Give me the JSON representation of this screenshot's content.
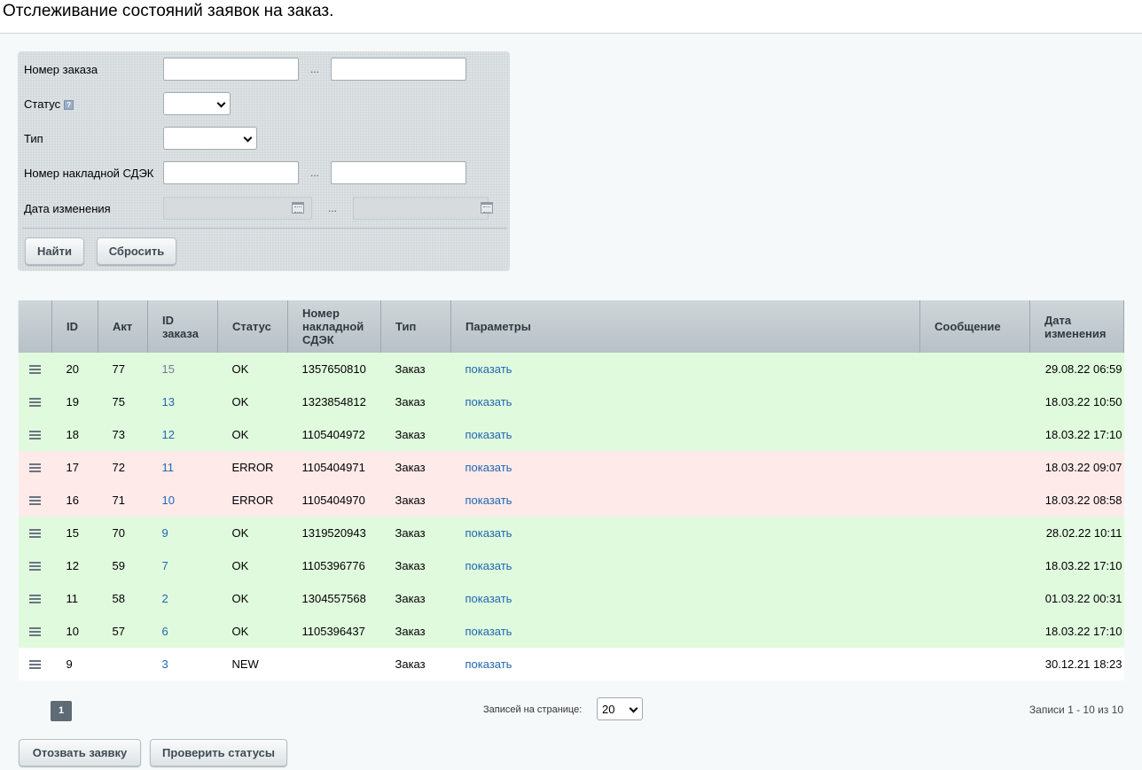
{
  "page": {
    "title": "Отслеживание состояний заявок на заказ."
  },
  "filter": {
    "order_number_label": "Номер заказа",
    "status_label": "Статус",
    "type_label": "Тип",
    "cdek_waybill_label": "Номер накладной СДЭК",
    "date_changed_label": "Дата изменения",
    "range_separator": "...",
    "order_number_from": "",
    "order_number_to": "",
    "status_value": "",
    "type_value": "",
    "cdek_waybill_from": "",
    "cdek_waybill_to": "",
    "date_from": "",
    "date_to": "",
    "find_button": "Найти",
    "reset_button": "Сбросить"
  },
  "table": {
    "columns": [
      "",
      "ID",
      "Акт",
      "ID заказа",
      "Статус",
      "Номер накладной СДЭК",
      "Тип",
      "Параметры",
      "Сообщение",
      "Дата изменения"
    ],
    "rows": [
      {
        "id": "20",
        "act": "77",
        "order_id": "15",
        "status": "OK",
        "waybill": "1357650810",
        "type": "Заказ",
        "params": "показать",
        "message": "",
        "date": "29.08.22 06:59"
      },
      {
        "id": "19",
        "act": "75",
        "order_id": "13",
        "status": "OK",
        "waybill": "1323854812",
        "type": "Заказ",
        "params": "показать",
        "message": "",
        "date": "18.03.22 10:50"
      },
      {
        "id": "18",
        "act": "73",
        "order_id": "12",
        "status": "OK",
        "waybill": "1105404972",
        "type": "Заказ",
        "params": "показать",
        "message": "",
        "date": "18.03.22 17:10"
      },
      {
        "id": "17",
        "act": "72",
        "order_id": "11",
        "status": "ERROR",
        "waybill": "1105404971",
        "type": "Заказ",
        "params": "показать",
        "message": "",
        "date": "18.03.22 09:07"
      },
      {
        "id": "16",
        "act": "71",
        "order_id": "10",
        "status": "ERROR",
        "waybill": "1105404970",
        "type": "Заказ",
        "params": "показать",
        "message": "",
        "date": "18.03.22 08:58"
      },
      {
        "id": "15",
        "act": "70",
        "order_id": "9",
        "status": "OK",
        "waybill": "1319520943",
        "type": "Заказ",
        "params": "показать",
        "message": "",
        "date": "28.02.22 10:11"
      },
      {
        "id": "12",
        "act": "59",
        "order_id": "7",
        "status": "OK",
        "waybill": "1105396776",
        "type": "Заказ",
        "params": "показать",
        "message": "",
        "date": "18.03.22 17:10"
      },
      {
        "id": "11",
        "act": "58",
        "order_id": "2",
        "status": "OK",
        "waybill": "1304557568",
        "type": "Заказ",
        "params": "показать",
        "message": "",
        "date": "01.03.22 00:31"
      },
      {
        "id": "10",
        "act": "57",
        "order_id": "6",
        "status": "OK",
        "waybill": "1105396437",
        "type": "Заказ",
        "params": "показать",
        "message": "",
        "date": "18.03.22 17:10"
      },
      {
        "id": "9",
        "act": "",
        "order_id": "3",
        "status": "NEW",
        "waybill": "",
        "type": "Заказ",
        "params": "показать",
        "message": "",
        "date": "30.12.21 18:23"
      }
    ]
  },
  "pagination": {
    "current_page": "1",
    "per_page_label": "Записей на странице:",
    "per_page_value": "20",
    "records_info": "Записи 1 - 10 из 10"
  },
  "actions": {
    "revoke_button": "Отозвать заявку",
    "check_status_button": "Проверить статусы"
  },
  "colors": {
    "ok_row": "#e0fadd",
    "error_row": "#ffeaea",
    "new_row": "#ffffff",
    "link": "#2067b0"
  }
}
